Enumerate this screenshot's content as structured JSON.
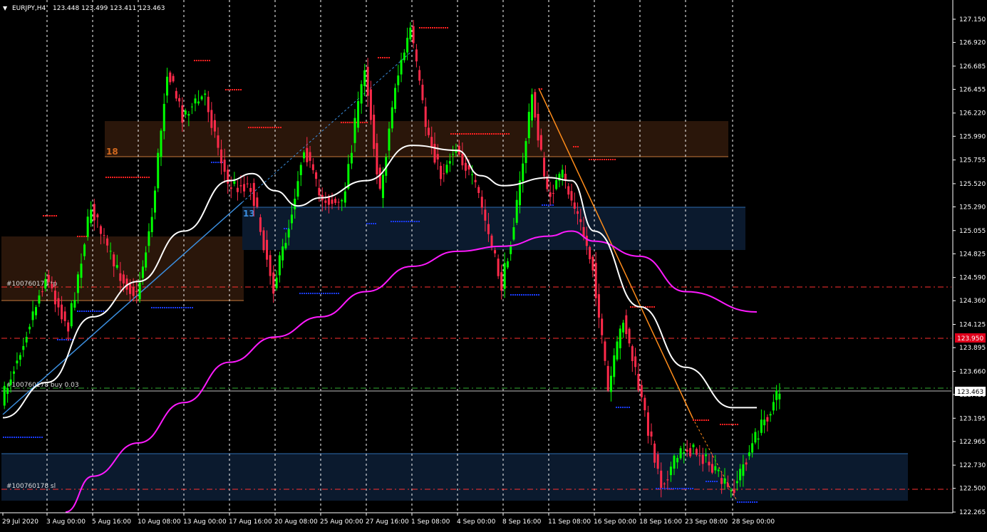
{
  "header": {
    "menu_arrow": "▼",
    "symbol": "EURJPY,H4",
    "ohlc": "123.448 123.499 123.411 123.463"
  },
  "colors": {
    "background": "#000000",
    "bull": "#00ff00",
    "bear": "#ff2a4a",
    "ma_fast": "#ffffff",
    "ma_slow": "#ff1aff",
    "zone_brown": "#2a160a",
    "zone_blue": "#0b1a2e",
    "level_red": "#ff3030",
    "resistance_dots": "#ff2020",
    "support_dots": "#1a3cff",
    "trendline_orange": "#ff8c1a",
    "trendline_blue": "#3b8fe0",
    "axis_text": "#ffffff"
  },
  "zones": {
    "zone_a_label": "18",
    "zone_b_label": "13"
  },
  "order_labels": {
    "tp": "#100760178 tp",
    "buy": "#100760178 buy 0.03",
    "sl": "#100760178 sl"
  },
  "price_tags": {
    "red_level": "123.950",
    "current": "123.463"
  },
  "chart_data": {
    "type": "candlestick",
    "symbol": "EURJPY",
    "timeframe": "H4",
    "ylim": [
      122.25,
      127.25
    ],
    "y_ticks": [
      "127.150",
      "126.920",
      "126.685",
      "126.455",
      "126.220",
      "125.990",
      "125.755",
      "125.520",
      "125.290",
      "125.055",
      "124.825",
      "124.590",
      "124.360",
      "124.125",
      "123.895",
      "123.660",
      "123.430",
      "123.195",
      "122.965",
      "122.730",
      "122.500",
      "122.265"
    ],
    "x_ticks": [
      "29 Jul 2020",
      "3 Aug 00:00",
      "5 Aug 16:00",
      "10 Aug 08:00",
      "13 Aug 00:00",
      "17 Aug 16:00",
      "20 Aug 08:00",
      "25 Aug 00:00",
      "27 Aug 16:00",
      "1 Sep 08:00",
      "4 Sep 00:00",
      "8 Sep 16:00",
      "11 Sep 08:00",
      "16 Sep 00:00",
      "18 Sep 16:00",
      "23 Sep 08:00",
      "28 Sep 00:00"
    ],
    "price_path": [
      {
        "t": "29 Jul 2020",
        "p": 123.35
      },
      {
        "t": "3 Aug 00:00",
        "p": 124.6
      },
      {
        "t": "4 Aug",
        "p": 124.1
      },
      {
        "t": "5 Aug 16:00",
        "p": 125.3
      },
      {
        "t": "7 Aug",
        "p": 124.7
      },
      {
        "t": "10 Aug 08:00",
        "p": 124.4
      },
      {
        "t": "11 Aug",
        "p": 125.2
      },
      {
        "t": "12 Aug",
        "p": 126.65
      },
      {
        "t": "13 Aug 00:00",
        "p": 126.2
      },
      {
        "t": "14 Aug",
        "p": 126.4
      },
      {
        "t": "17 Aug 16:00",
        "p": 125.5
      },
      {
        "t": "19 Aug",
        "p": 125.5
      },
      {
        "t": "20 Aug 08:00",
        "p": 124.5
      },
      {
        "t": "21 Aug",
        "p": 125.1
      },
      {
        "t": "24 Aug",
        "p": 125.9
      },
      {
        "t": "25 Aug 00:00",
        "p": 125.4
      },
      {
        "t": "26 Aug",
        "p": 125.3
      },
      {
        "t": "27 Aug 16:00",
        "p": 126.7
      },
      {
        "t": "28 Aug",
        "p": 125.4
      },
      {
        "t": "31 Aug",
        "p": 126.5
      },
      {
        "t": "1 Sep 08:00",
        "p": 127.05
      },
      {
        "t": "2 Sep",
        "p": 126.1
      },
      {
        "t": "3 Sep",
        "p": 125.6
      },
      {
        "t": "4 Sep 00:00",
        "p": 125.9
      },
      {
        "t": "7 Sep",
        "p": 125.4
      },
      {
        "t": "8 Sep 16:00",
        "p": 124.5
      },
      {
        "t": "9 Sep",
        "p": 125.3
      },
      {
        "t": "10 Sep",
        "p": 126.4
      },
      {
        "t": "11 Sep 08:00",
        "p": 125.4
      },
      {
        "t": "14 Sep",
        "p": 125.6
      },
      {
        "t": "15 Sep",
        "p": 125.2
      },
      {
        "t": "16 Sep 00:00",
        "p": 124.7
      },
      {
        "t": "17 Sep",
        "p": 123.45
      },
      {
        "t": "18 Sep",
        "p": 124.2
      },
      {
        "t": "18 Sep 16:00",
        "p": 123.5
      },
      {
        "t": "21 Sep",
        "p": 122.55
      },
      {
        "t": "23 Sep 08:00",
        "p": 122.9
      },
      {
        "t": "24 Sep",
        "p": 122.85
      },
      {
        "t": "25 Sep",
        "p": 122.65
      },
      {
        "t": "28 Sep 00:00",
        "p": 122.45
      },
      {
        "t": "28 Sep 12:00",
        "p": 123.0
      },
      {
        "t": "29 Sep",
        "p": 123.463
      }
    ],
    "ma_fast_path": [
      {
        "t": "29 Jul 2020",
        "p": 123.2
      },
      {
        "t": "3 Aug 00:00",
        "p": 123.55
      },
      {
        "t": "5 Aug 16:00",
        "p": 124.2
      },
      {
        "t": "10 Aug 08:00",
        "p": 124.55
      },
      {
        "t": "13 Aug 00:00",
        "p": 125.05
      },
      {
        "t": "17 Aug 16:00",
        "p": 125.55
      },
      {
        "t": "19 Aug",
        "p": 125.62
      },
      {
        "t": "20 Aug 08:00",
        "p": 125.45
      },
      {
        "t": "24 Aug",
        "p": 125.3
      },
      {
        "t": "25 Aug 00:00",
        "p": 125.38
      },
      {
        "t": "27 Aug 16:00",
        "p": 125.55
      },
      {
        "t": "1 Sep 08:00",
        "p": 125.9
      },
      {
        "t": "4 Sep 00:00",
        "p": 125.85
      },
      {
        "t": "7 Sep",
        "p": 125.6
      },
      {
        "t": "8 Sep 16:00",
        "p": 125.5
      },
      {
        "t": "11 Sep 08:00",
        "p": 125.58
      },
      {
        "t": "14 Sep",
        "p": 125.55
      },
      {
        "t": "16 Sep 00:00",
        "p": 125.05
      },
      {
        "t": "18 Sep 16:00",
        "p": 124.3
      },
      {
        "t": "23 Sep 08:00",
        "p": 123.7
      },
      {
        "t": "28 Sep 00:00",
        "p": 123.3
      },
      {
        "t": "29 Sep",
        "p": 123.3
      }
    ],
    "ma_slow_path": [
      {
        "t": "3 Aug 00:00",
        "p": 122.25
      },
      {
        "t": "5 Aug 16:00",
        "p": 122.62
      },
      {
        "t": "10 Aug 08:00",
        "p": 122.95
      },
      {
        "t": "13 Aug 00:00",
        "p": 123.35
      },
      {
        "t": "17 Aug 16:00",
        "p": 123.75
      },
      {
        "t": "20 Aug 08:00",
        "p": 124.0
      },
      {
        "t": "25 Aug 00:00",
        "p": 124.2
      },
      {
        "t": "27 Aug 16:00",
        "p": 124.45
      },
      {
        "t": "1 Sep 08:00",
        "p": 124.7
      },
      {
        "t": "4 Sep 00:00",
        "p": 124.85
      },
      {
        "t": "8 Sep 16:00",
        "p": 124.9
      },
      {
        "t": "11 Sep 08:00",
        "p": 125.0
      },
      {
        "t": "14 Sep",
        "p": 125.05
      },
      {
        "t": "16 Sep 00:00",
        "p": 124.95
      },
      {
        "t": "18 Sep 16:00",
        "p": 124.8
      },
      {
        "t": "23 Sep 08:00",
        "p": 124.45
      },
      {
        "t": "28 Sep 00:00",
        "p": 124.25
      }
    ],
    "levels": {
      "tp": 124.5,
      "red_level": 123.95,
      "buy_entry": 123.5,
      "current": 123.463,
      "sl": 122.5
    }
  }
}
